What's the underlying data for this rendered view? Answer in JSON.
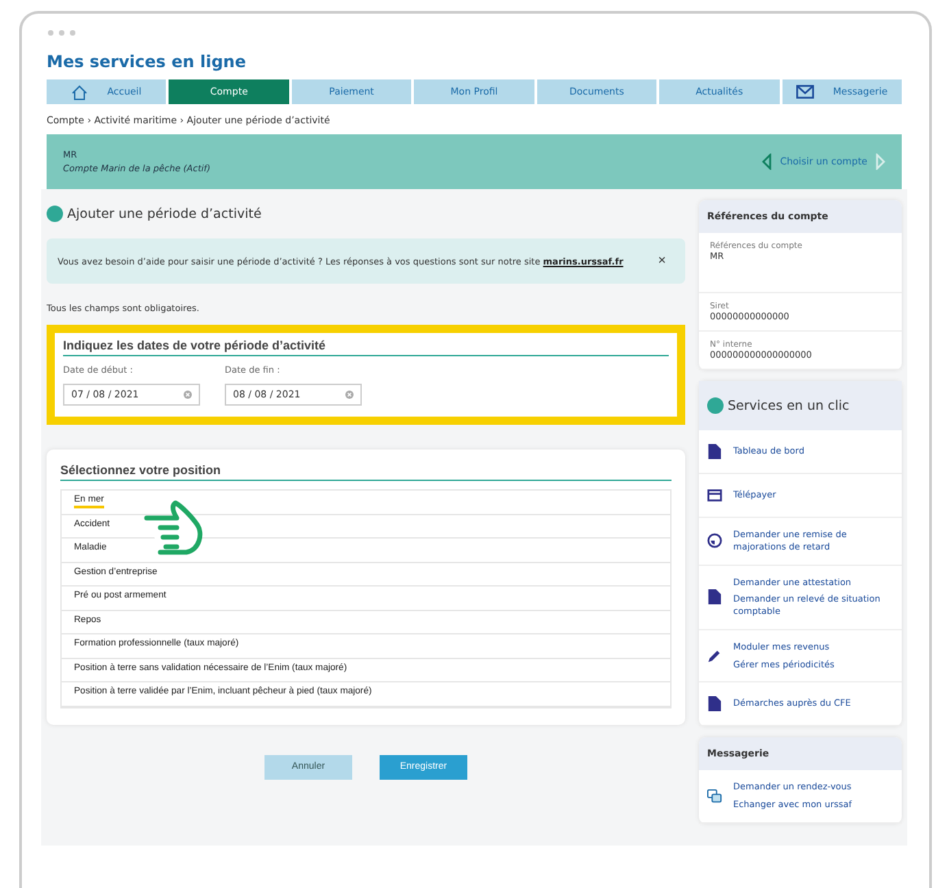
{
  "site_title": "Mes services en ligne",
  "nav": [
    {
      "label": "Accueil",
      "selected": false,
      "kind": "home"
    },
    {
      "label": "Compte",
      "selected": true
    },
    {
      "label": "Paiement",
      "selected": false
    },
    {
      "label": "Mon Profil",
      "selected": false
    },
    {
      "label": "Documents",
      "selected": false
    },
    {
      "label": "Actualités",
      "selected": false
    },
    {
      "label": "Messagerie",
      "selected": false,
      "kind": "mail"
    }
  ],
  "breadcrumb": "Compte › Activité maritime › Ajouter une période d’activité",
  "account_banner": {
    "line_1": "MR",
    "line_2": "Compte Marin de la pêche (Actif)",
    "choose": "Choisir un compte"
  },
  "page_heading": "Ajouter une période d’activité",
  "help": {
    "text": "Vous avez besoin d’aide pour saisir une période d’activité ? Les réponses à vos questions sont sur notre site ",
    "link": "marins.urssaf.fr",
    "close": "×"
  },
  "required_note": "Tous les champs sont obligatoires.",
  "dates": {
    "title": "Indiquez les dates de votre période d’activité",
    "fields": [
      {
        "label": "Date de début :",
        "value": "07 / 08 / 2021"
      },
      {
        "label": "Date de fin :",
        "value": "08 / 08 / 2021"
      }
    ]
  },
  "position": {
    "title": "Sélectionnez votre position",
    "options": [
      {
        "label": "En mer",
        "selected": true
      },
      {
        "label": "Accident",
        "selected": false
      },
      {
        "label": "Maladie",
        "selected": false
      },
      {
        "label": "Gestion d’entreprise",
        "selected": false
      },
      {
        "label": "Pré ou post armement",
        "selected": false
      },
      {
        "label": "Repos",
        "selected": false
      },
      {
        "label": "Formation professionnelle (taux majoré)",
        "selected": false
      },
      {
        "label": "Position à terre sans validation nécessaire de l’Enim (taux majoré)",
        "selected": false
      },
      {
        "label": "Position à terre validée par l’Enim, incluant pêcheur à pied (taux majoré)",
        "selected": false
      }
    ]
  },
  "buttons": [
    {
      "label": "Annuler",
      "kind": "secondary"
    },
    {
      "label": "Enregistrer",
      "kind": "primary"
    }
  ],
  "references": {
    "title": "Références du compte",
    "items": [
      {
        "label": "Références du compte",
        "value": "MR"
      },
      {
        "label": "Siret",
        "value": "00000000000000"
      },
      {
        "label": "N° interne",
        "value": "000000000000000000"
      }
    ]
  },
  "services": {
    "title": "Services en un clic",
    "items": [
      {
        "kind": "document",
        "links": [
          "Tableau de bord"
        ]
      },
      {
        "kind": "card",
        "links": [
          "Télépayer"
        ]
      },
      {
        "kind": "clock",
        "links": [
          "Demander une remise de majorations de retard"
        ]
      },
      {
        "kind": "document",
        "links": [
          "Demander une attestation",
          "Demander un relevé de situation comptable"
        ]
      },
      {
        "kind": "pencil",
        "links": [
          "Moduler mes revenus",
          "Gérer mes périodicités"
        ]
      },
      {
        "kind": "document",
        "links": [
          "Démarches auprès du CFE"
        ]
      }
    ]
  },
  "messagerie": {
    "title": "Messagerie",
    "items": [
      {
        "kind": "chat",
        "links": [
          "Demander un rendez-vous",
          "Echanger avec mon urssaf"
        ]
      }
    ]
  }
}
